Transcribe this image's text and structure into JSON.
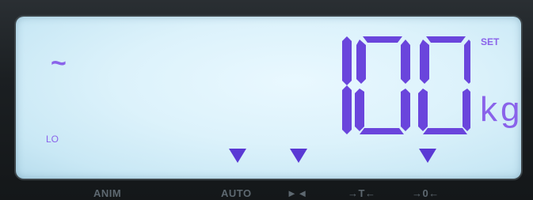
{
  "display": {
    "weight_value": "100",
    "unit": "kg",
    "stable_indicator": "~",
    "lo_label": "LO",
    "set_label": "SET",
    "indicator_markers_lit": 3
  },
  "bezel_labels": {
    "anim": "ANIM",
    "auto": "AUTO",
    "sym1": "►◄",
    "sym2": "→T←",
    "sym3": "→0←"
  },
  "colors": {
    "lcd_background": "#dcf2fb",
    "segment_color": "#6a45dc",
    "annunciator_color": "#8a63ea"
  }
}
